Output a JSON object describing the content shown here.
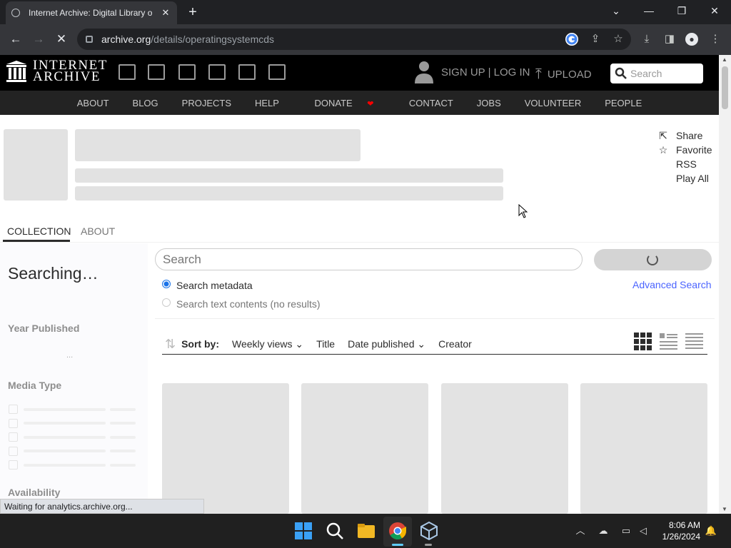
{
  "browser": {
    "tab_title": "Internet Archive: Digital Library o",
    "url_domain": "archive.org",
    "url_path": "/details/operatingsystemcds",
    "status_text": "Waiting for analytics.archive.org..."
  },
  "ia": {
    "logo_line1": "INTERNET",
    "logo_line2": "ARCHIVE",
    "signup": "SIGN UP | LOG IN",
    "upload": "UPLOAD",
    "search_placeholder": "Search",
    "subnav": [
      "ABOUT",
      "BLOG",
      "PROJECTS",
      "HELP",
      "DONATE",
      "CONTACT",
      "JOBS",
      "VOLUNTEER",
      "PEOPLE"
    ]
  },
  "actions": {
    "share": "Share",
    "favorite": "Favorite",
    "rss": "RSS",
    "play_all": "Play All"
  },
  "tabs": {
    "collection": "COLLECTION",
    "about": "ABOUT"
  },
  "left": {
    "searching": "Searching…",
    "year_published": "Year Published",
    "ellipsis": "...",
    "media_type": "Media Type",
    "availability": "Availability"
  },
  "search": {
    "placeholder": "Search",
    "opt_metadata": "Search metadata",
    "opt_text": "Search text contents (no results)",
    "advanced": "Advanced Search"
  },
  "sort": {
    "label": "Sort by:",
    "weekly": "Weekly views",
    "title": "Title",
    "date": "Date published",
    "creator": "Creator"
  },
  "taskbar": {
    "time": "8:06 AM",
    "date": "1/26/2024"
  }
}
